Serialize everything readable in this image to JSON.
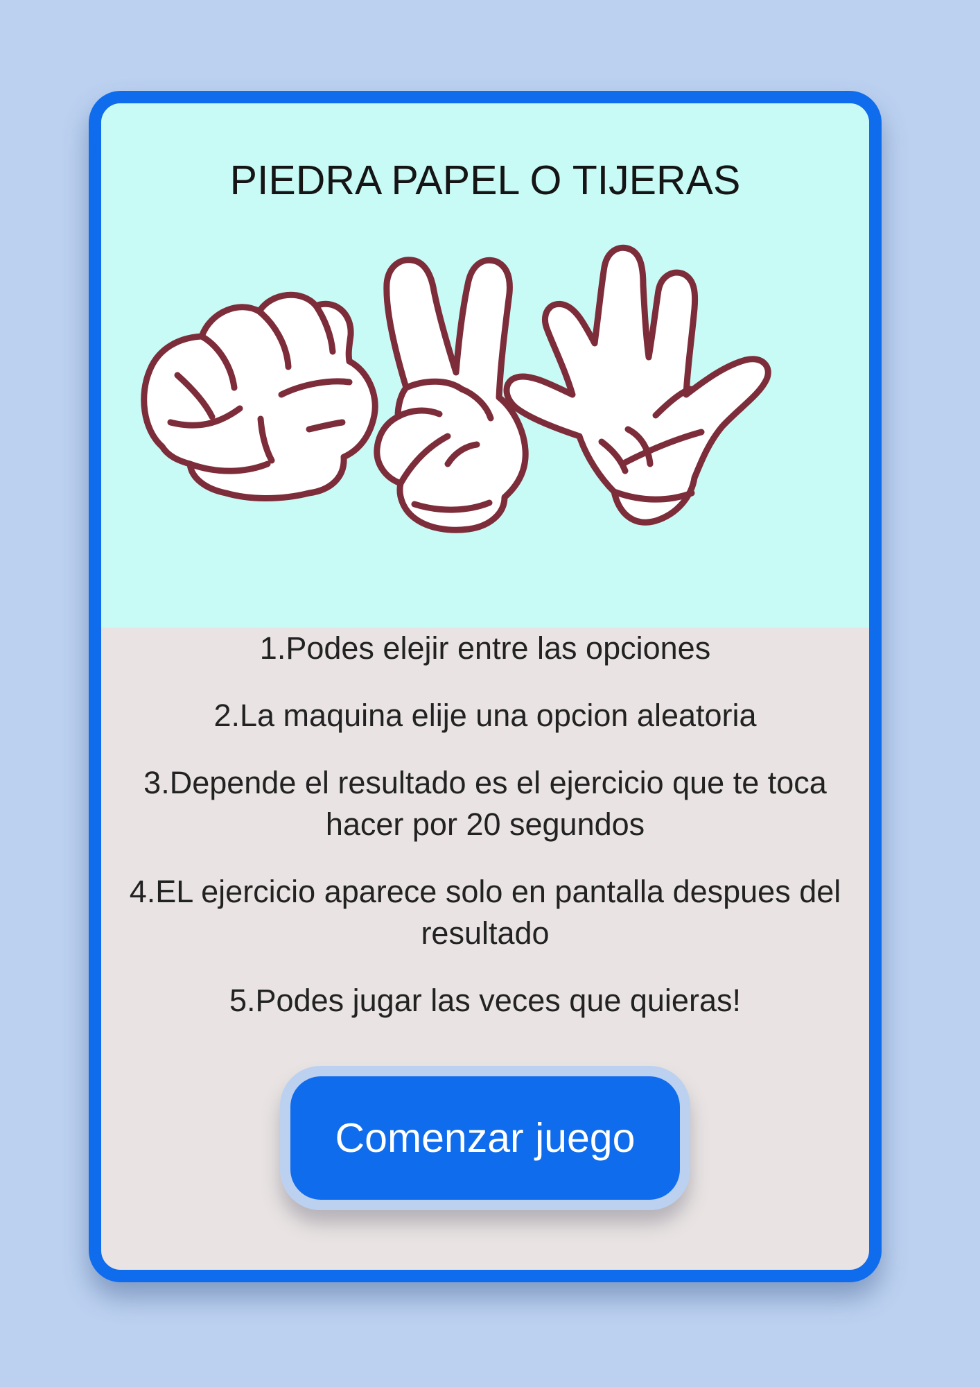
{
  "title": "PIEDRA PAPEL O TIJERAS",
  "rules": [
    "1.Podes elejir entre las opciones",
    "2.La maquina elije una opcion aleatoria",
    "3.Depende el resultado es el ejercicio que te toca hacer por 20 segundos",
    "4.EL ejercicio aparece solo en pantalla despues del resultado",
    "5.Podes jugar las veces que quieras!"
  ],
  "start_button_label": "Comenzar juego",
  "icons": [
    "rock-fist-icon",
    "scissors-peace-hand-icon",
    "paper-open-hand-icon"
  ],
  "colors": {
    "page_background": "#bcd1f0",
    "card_border": "#0f6cec",
    "hero_background": "#c9fbf6",
    "card_body": "#e9e4e3",
    "button": "#0f6cec",
    "hand_outline": "#7d2d3a"
  }
}
